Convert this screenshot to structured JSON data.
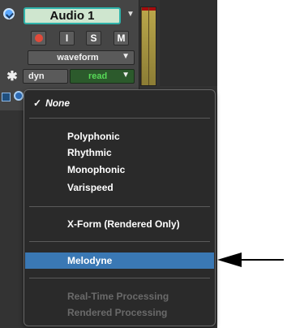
{
  "track": {
    "name": "Audio 1",
    "buttons": {
      "rec": "",
      "input": "I",
      "solo": "S",
      "mute": "M"
    },
    "view_select": "waveform",
    "automation_label": "dyn",
    "automation_mode": "read",
    "icons": [
      "track-color-icon",
      "record-icon",
      "asterisk-icon",
      "clip-icon",
      "timebase-icon"
    ]
  },
  "menu": {
    "items": [
      {
        "label": "None",
        "checked": true
      },
      {
        "label": "Polyphonic"
      },
      {
        "label": "Rhythmic"
      },
      {
        "label": "Monophonic"
      },
      {
        "label": "Varispeed"
      },
      {
        "label": "X-Form (Rendered Only)"
      },
      {
        "label": "Melodyne",
        "selected": true
      },
      {
        "label": "Real-Time Processing",
        "disabled": true
      },
      {
        "label": "Rendered Processing",
        "disabled": true
      }
    ]
  },
  "colors": {
    "menu_bg": "#2a2a2a",
    "selection": "#3a78b4",
    "track_name_border": "#2fb3aa",
    "read_text": "#57d957",
    "record": "#e14a3a"
  }
}
